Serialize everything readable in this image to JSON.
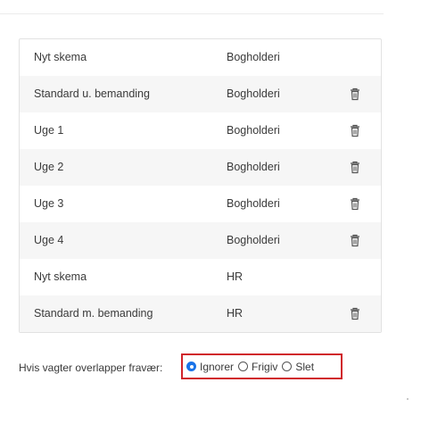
{
  "schedules": [
    {
      "name": "Nyt skema",
      "department": "Bogholderi",
      "deletable": false
    },
    {
      "name": "Standard u. bemanding",
      "department": "Bogholderi",
      "deletable": true
    },
    {
      "name": "Uge 1",
      "department": "Bogholderi",
      "deletable": true
    },
    {
      "name": "Uge 2",
      "department": "Bogholderi",
      "deletable": true
    },
    {
      "name": "Uge 3",
      "department": "Bogholderi",
      "deletable": true
    },
    {
      "name": "Uge 4",
      "department": "Bogholderi",
      "deletable": true
    },
    {
      "name": "Nyt skema",
      "department": "HR",
      "deletable": false
    },
    {
      "name": "Standard m. bemanding",
      "department": "HR",
      "deletable": true
    }
  ],
  "overlap": {
    "label": "Hvis vagter overlapper fravær:",
    "options": [
      {
        "label": "Ignorer",
        "checked": true
      },
      {
        "label": "Frigiv",
        "checked": false
      },
      {
        "label": "Slet",
        "checked": false
      }
    ]
  },
  "icons": {
    "delete": "trash-icon"
  },
  "colors": {
    "highlight_border": "#d0242b",
    "radio_selected": "#1a73e8",
    "row_alt": "#f6f6f6"
  }
}
